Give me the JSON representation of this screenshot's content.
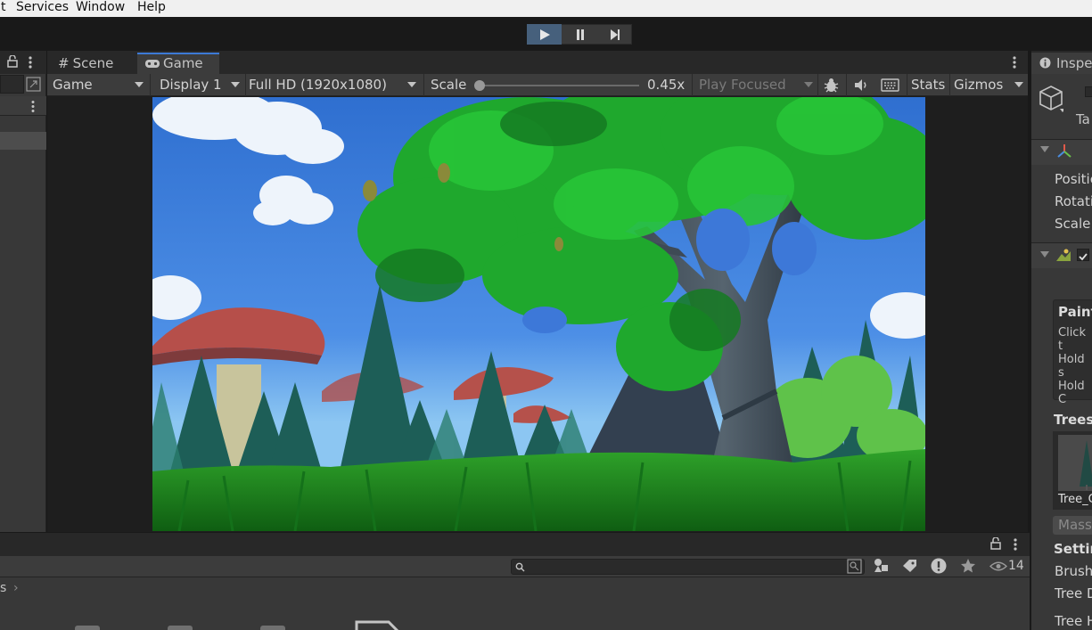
{
  "menu": {
    "items": [
      "t",
      "Services",
      "Window",
      "Help"
    ]
  },
  "scene_tabs": {
    "scene_label": "Scene",
    "game_label": "Game"
  },
  "game_toolbar": {
    "mode": "Game",
    "display": "Display 1",
    "resolution": "Full HD (1920x1080)",
    "scale_label": "Scale",
    "scale_value": "0.45x",
    "play_mode": "Play Focused",
    "stats_label": "Stats",
    "gizmos_label": "Gizmos"
  },
  "inspector": {
    "tab_label": "Inspe",
    "tag_label": "Ta",
    "transform": {
      "position_label": "Positic",
      "rotation_label": "Rotatic",
      "scale_label": "Scale"
    },
    "paint": {
      "title": "Paint",
      "line1": "Click t",
      "line2": "Hold s",
      "line3": "Hold C"
    },
    "trees_label": "Trees",
    "tree_item": "Tree_C",
    "mass_button": "Mass",
    "settings_label": "Settin",
    "brush_label": "Brush",
    "tree_d_label": "Tree D",
    "tree_h_label": "Tree H"
  },
  "bottom": {
    "breadcrumb": "s",
    "visible_count": "14"
  },
  "colors": {
    "accent": "#3d7ad6",
    "play_active": "#46607c",
    "panel": "#383838",
    "toolbar": "#3c3c3c",
    "sky": "#3d78d8",
    "grass": "#1f8a1f"
  }
}
